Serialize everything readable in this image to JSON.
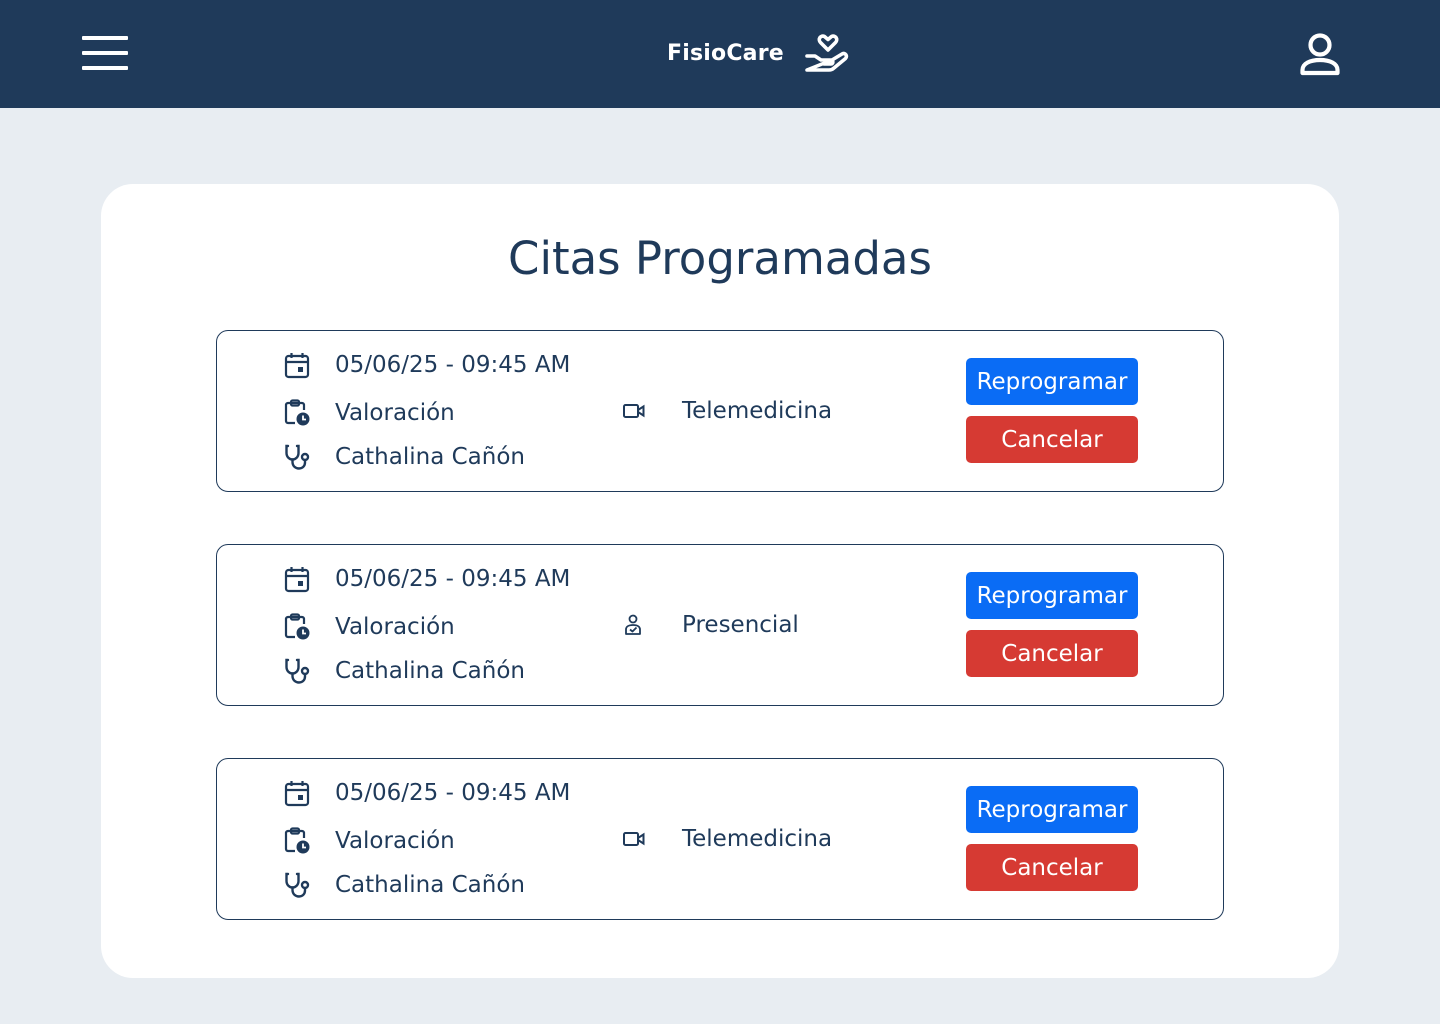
{
  "app": {
    "name": "FisioCare",
    "colors": {
      "primary": "#1f3a5a",
      "accent": "#0a6cf5",
      "danger": "#d63a33",
      "background": "#e8edf2"
    },
    "icons": {
      "menu": "menu-icon",
      "brand": "hand-heart-icon",
      "user": "user-icon"
    }
  },
  "page": {
    "title": "Citas Programadas"
  },
  "appointments": [
    {
      "datetime": "05/06/25 - 09:45 AM",
      "type": "Valoración",
      "mode": "Telemedicina",
      "mode_icon": "video-icon",
      "therapist": "Cathalina Cañón",
      "reschedule_label": "Reprogramar",
      "cancel_label": "Cancelar"
    },
    {
      "datetime": "05/06/25 - 09:45 AM",
      "type": "Valoración",
      "mode": "Presencial",
      "mode_icon": "in-person-icon",
      "therapist": "Cathalina Cañón",
      "reschedule_label": "Reprogramar",
      "cancel_label": "Cancelar"
    },
    {
      "datetime": "05/06/25 - 09:45 AM",
      "type": "Valoración",
      "mode": "Telemedicina",
      "mode_icon": "video-icon",
      "therapist": "Cathalina Cañón",
      "reschedule_label": "Reprogramar",
      "cancel_label": "Cancelar"
    }
  ]
}
